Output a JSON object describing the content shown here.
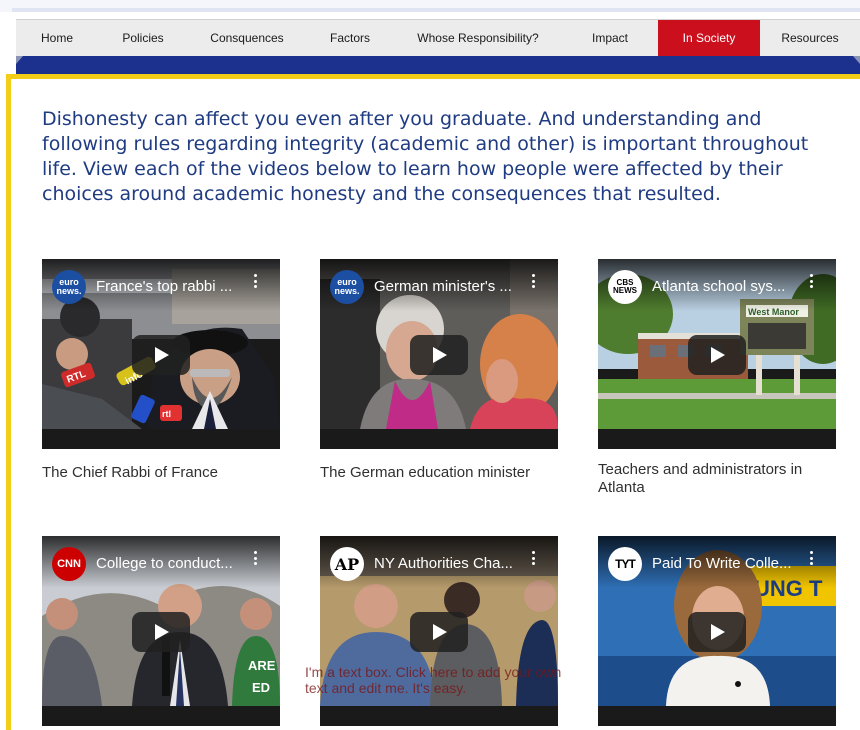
{
  "nav": {
    "items": [
      "Home",
      "Policies",
      "Consquences",
      "Factors",
      "Whose Responsibility?",
      "Impact",
      "In Society",
      "Resources"
    ],
    "active": "In Society"
  },
  "intro": "Dishonesty can affect you even after you graduate. And understanding and following rules regarding integrity (academic and other) is important throughout life. View each of the videos below to learn how people were affected by their choices around academic honesty and the consequences that resulted.",
  "videos": [
    {
      "channel": "euro news.",
      "title": "France's top rabbi ...",
      "caption": "The Chief Rabbi of France"
    },
    {
      "channel": "euro news.",
      "title": "German minister's ...",
      "caption": "The German education minister"
    },
    {
      "channel": "CBS NEWS",
      "title": "Atlanta school sys...",
      "caption": "Teachers and administrators in Atlanta"
    },
    {
      "channel": "CNN",
      "title": "College to conduct...",
      "caption": ""
    },
    {
      "channel": "AP",
      "title": "NY Authorities Cha...",
      "caption": ""
    },
    {
      "channel": "TYT",
      "title": "Paid To Write Colle...",
      "caption": ""
    }
  ],
  "thumb_texts": {
    "mic_flags": [
      "RTL",
      "info",
      "rtl"
    ],
    "school_sign": "West Manor",
    "cnn_shirt": "ARE\nED",
    "tyt_backdrop": "UNG T"
  },
  "placeholder_text": "I'm a text box. Click here to add your own text and edit me. It's easy."
}
